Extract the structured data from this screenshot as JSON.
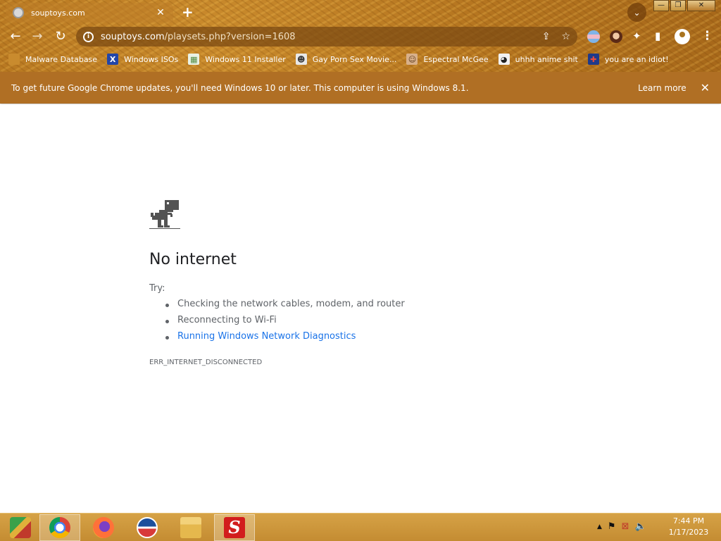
{
  "tab": {
    "title": "souptoys.com",
    "close": "✕",
    "new_tab": "+"
  },
  "window_controls": {
    "minimize": "—",
    "restore": "❐",
    "close": "✕"
  },
  "toolbar": {
    "back": "←",
    "forward": "→",
    "reload": "↻",
    "url_domain": "souptoys.com",
    "url_path": "/playsets.php?version=1608",
    "share_icon": "⇪",
    "star_icon": "☆",
    "extensions_icon": "✦",
    "sidebar_icon": "▮",
    "menu": "⋮",
    "tab_search": "⌄"
  },
  "bookmarks": [
    {
      "label": "Malware Database",
      "icon": "folder-icon",
      "color": "#c98b2e",
      "glyph": ""
    },
    {
      "label": "Windows ISOs",
      "icon": "x-icon",
      "color": "#2346a8",
      "glyph": "X"
    },
    {
      "label": "Windows 11 Installer",
      "icon": "image-icon",
      "color": "#7bb36a",
      "glyph": "▦"
    },
    {
      "label": "Gay Porn Sex Movie...",
      "icon": "robot-icon",
      "color": "#3c3c3c",
      "glyph": "☻"
    },
    {
      "label": "Espectral McGee",
      "icon": "avatar-icon",
      "color": "#5a3a1d",
      "glyph": "☺"
    },
    {
      "label": "uhhh anime shit",
      "icon": "anime-icon",
      "color": "#222222",
      "glyph": "◕"
    },
    {
      "label": "you are an idiot!",
      "icon": "flag-icon",
      "color": "#c0392b",
      "glyph": "✚"
    }
  ],
  "infobar": {
    "message": "To get future Google Chrome updates, you'll need Windows 10 or later. This computer is using Windows 8.1.",
    "learn_more": "Learn more",
    "close": "✕"
  },
  "error_page": {
    "title": "No internet",
    "try_label": "Try:",
    "tips": [
      "Checking the network cables, modem, and router",
      "Reconnecting to Wi-Fi",
      "Running Windows Network Diagnostics"
    ],
    "error_code": "ERR_INTERNET_DISCONNECTED"
  },
  "taskbar": {
    "apps": [
      "start-app",
      "chrome",
      "firefox",
      "obama-logo-app",
      "file-explorer",
      "s-app"
    ],
    "tray": {
      "up_arrow": "▲",
      "flag": "⚑",
      "network": "⊠",
      "volume": "🔈"
    },
    "time": "7:44 PM",
    "date": "1/17/2023"
  },
  "colors": {
    "theme_brown": "#b06f24",
    "link_blue": "#1a73e8",
    "error_text": "#5f6368"
  }
}
